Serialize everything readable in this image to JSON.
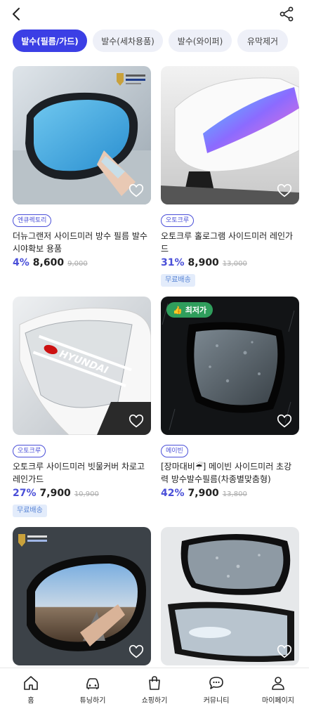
{
  "header": {
    "back_icon": "chevron-left-icon",
    "share_icon": "share-icon"
  },
  "chips": [
    {
      "label": "발수(필름/가드)",
      "active": true
    },
    {
      "label": "발수(세차용품)",
      "active": false
    },
    {
      "label": "발수(와이퍼)",
      "active": false
    },
    {
      "label": "유막제거",
      "active": false
    }
  ],
  "products": [
    {
      "brand": "엔큐렉토리",
      "title": "더뉴그랜저 사이드미러 방수 필름 발수 시야확보 용품",
      "discount": "4%",
      "price": "8,600",
      "original_price": "9,000",
      "free_shipping": ""
    },
    {
      "brand": "오토크루",
      "title": "오토크루 홀로그램 사이드미러 레인가드",
      "discount": "31%",
      "price": "8,900",
      "original_price": "13,000",
      "free_shipping": "무료배송"
    },
    {
      "brand": "오토크루",
      "title": "오토크루 사이드미러 빗물커버 차로고 레인가드",
      "discount": "27%",
      "price": "7,900",
      "original_price": "10,900",
      "free_shipping": "무료배송",
      "image_text": "HYUNDAI"
    },
    {
      "brand": "메이빈",
      "title": "[장마대비☔] 메이빈 사이드미러 초강력 방수발수필름(차종별맞춤형)",
      "discount": "42%",
      "price": "7,900",
      "original_price": "13,800",
      "free_shipping": "",
      "badge": "최저가"
    },
    {
      "brand": "",
      "title": "",
      "discount": "",
      "price": "",
      "original_price": "",
      "free_shipping": ""
    },
    {
      "brand": "",
      "title": "",
      "discount": "",
      "price": "",
      "original_price": "",
      "free_shipping": ""
    }
  ],
  "bottom_nav": [
    {
      "label": "홈",
      "icon": "home-icon"
    },
    {
      "label": "튜닝하기",
      "icon": "car-icon"
    },
    {
      "label": "쇼핑하기",
      "icon": "shopping-bag-icon"
    },
    {
      "label": "커뮤니티",
      "icon": "chat-bubble-icon"
    },
    {
      "label": "마이페이지",
      "icon": "user-icon"
    }
  ]
}
